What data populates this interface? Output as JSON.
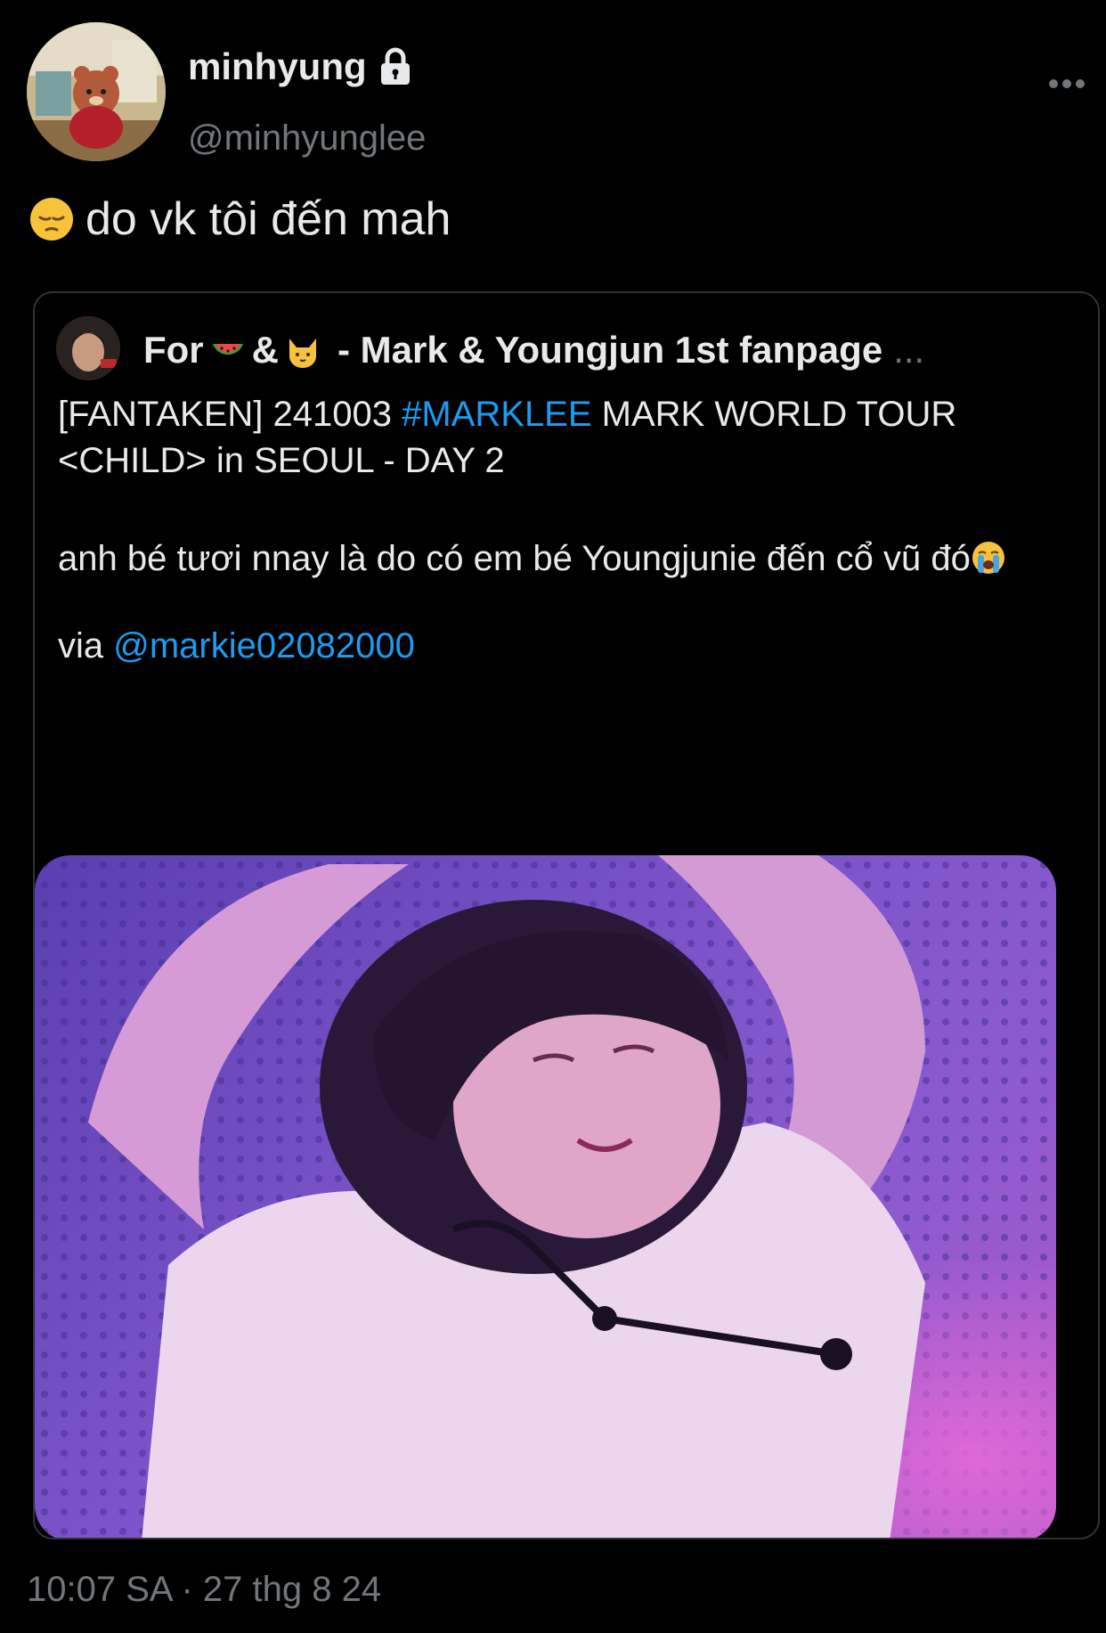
{
  "author": {
    "display_name": "minhyung",
    "handle": "@minhyunglee",
    "protected": true
  },
  "tweet": {
    "emoji": "pensive-face",
    "text": "do vk tôi đến mah",
    "timestamp": "10:07 SA · 27 thg 8 24"
  },
  "quoted_tweet": {
    "name_prefix": "For",
    "name_amp": "&",
    "name_suffix": "- Mark & Youngjun 1st fanpage",
    "name_ellipsis": "...",
    "name_emojis": [
      "watermelon",
      "cat-face"
    ],
    "line1_pre": "[FANTAKEN] 241003 ",
    "hashtag": "#MARKLEE",
    "line1_post": " MARK WORLD TOUR <CHILD> in SEOUL - DAY 2",
    "para2": "anh bé tươi nnay là do có em bé Youngjunie đến cổ vũ đó",
    "para2_emoji": "loudly-crying-face",
    "via_label": "via ",
    "via_mention": "@markie02082000",
    "media_description": "photo"
  },
  "colors": {
    "background": "#000000",
    "text_primary": "#e7e9ea",
    "text_secondary": "#71767b",
    "link": "#1d9bf0",
    "border": "#2f3336"
  }
}
